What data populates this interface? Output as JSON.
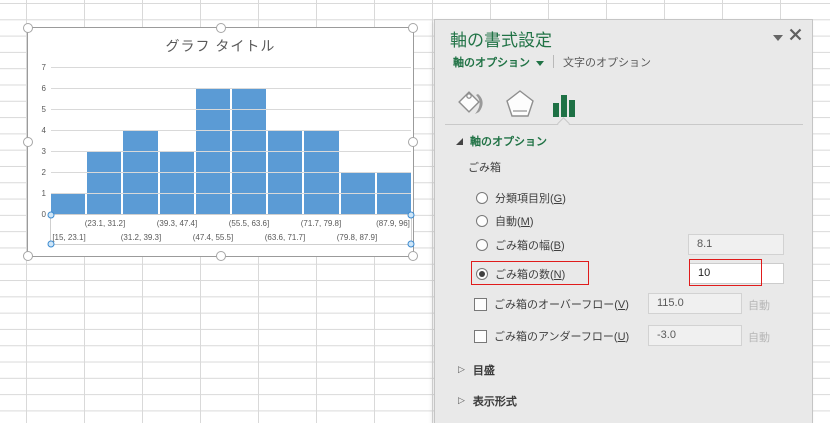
{
  "chart_data": {
    "type": "bar",
    "title": "グラフ タイトル",
    "categories": [
      "[15, 23.1]",
      "(23.1, 31.2]",
      "(31.2, 39.3]",
      "(39.3, 47.4]",
      "(47.4, 55.5]",
      "(55.5, 63.6]",
      "(63.6, 71.7]",
      "(71.7, 79.8]",
      "(79.8, 87.9]",
      "(87.9, 96]"
    ],
    "values": [
      1,
      3,
      4,
      3,
      6,
      6,
      4,
      4,
      2,
      2
    ],
    "xlabel": "",
    "ylabel": "",
    "ylim": [
      0,
      7
    ],
    "yticks": [
      0,
      1,
      2,
      3,
      4,
      5,
      6,
      7
    ],
    "bar_color": "#5B9BD5",
    "grid": true,
    "legend_position": "none",
    "xtick_layout": "staggered-two-rows",
    "histogram_selected_axis": true
  },
  "pane": {
    "title": "軸の書式設定",
    "tabs": [
      {
        "label": "軸のオプション",
        "selected": true
      },
      {
        "label": "文字のオプション",
        "selected": false
      }
    ],
    "icon_tabs": [
      {
        "name": "fill-and-line",
        "selected": false
      },
      {
        "name": "effects",
        "selected": false
      },
      {
        "name": "axis-options",
        "selected": true
      }
    ],
    "section_header": "軸のオプション",
    "group_label": "ごみ箱",
    "radio_options": [
      {
        "pre": "分類項目別(",
        "key": "G",
        "post": ")",
        "selected": false
      },
      {
        "pre": "自動(",
        "key": "M",
        "post": ")",
        "selected": false
      },
      {
        "pre": "ごみ箱の幅(",
        "key": "B",
        "post": ")",
        "selected": false,
        "value": "8.1"
      },
      {
        "pre": "ごみ箱の数(",
        "key": "N",
        "post": ")",
        "selected": true,
        "value": "10",
        "highlighted": true
      }
    ],
    "checkbox_options": [
      {
        "pre": "ごみ箱のオーバーフロー(",
        "key": "V",
        "post": ")",
        "checked": false,
        "value": "115.0",
        "suffix": "自動"
      },
      {
        "pre": "ごみ箱のアンダーフロー(",
        "key": "U",
        "post": ")",
        "checked": false,
        "value": "-3.0",
        "suffix": "自動"
      }
    ],
    "collapsed_sections": [
      {
        "label": "目盛"
      },
      {
        "label": "表示形式"
      }
    ],
    "accent_green": "#217346",
    "highlight_red": "#e01b1b"
  }
}
